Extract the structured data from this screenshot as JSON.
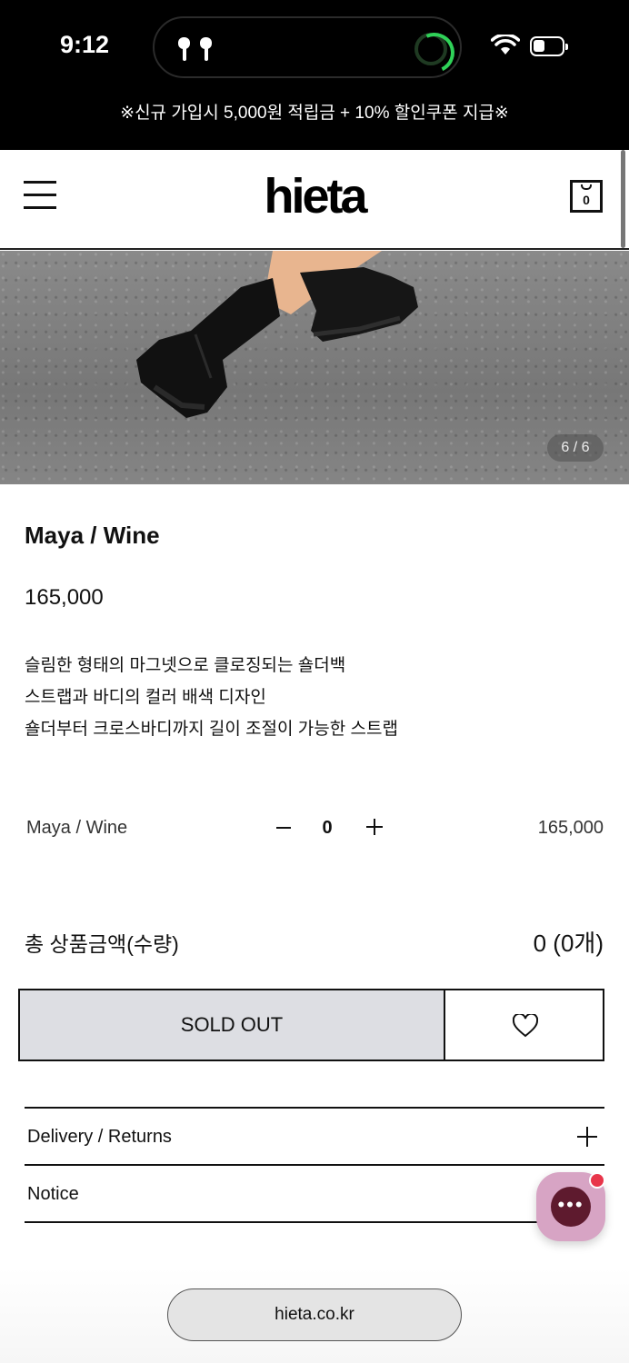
{
  "status_bar": {
    "time": "9:12"
  },
  "promo": {
    "text": "※신규 가입시 5,000원 적립금 + 10% 할인쿠폰 지급※"
  },
  "header": {
    "logo": "hieta",
    "cart_count": "0"
  },
  "gallery": {
    "pager": "6 / 6"
  },
  "product": {
    "title": "Maya / Wine",
    "price": "165,000",
    "description": [
      "슬림한 형태의 마그넷으로 클로징되는 숄더백",
      "스트랩과 바디의 컬러 배색 디자인",
      "숄더부터 크로스바디까지 길이 조절이 가능한 스트랩"
    ]
  },
  "option": {
    "name": "Maya / Wine",
    "quantity": "0",
    "price": "165,000"
  },
  "total": {
    "label": "총 상품금액(수량)",
    "value": "0 (0개)"
  },
  "actions": {
    "sold_out_label": "SOLD OUT"
  },
  "accordion": [
    {
      "label": "Delivery / Returns"
    },
    {
      "label": "Notice"
    }
  ],
  "browser": {
    "url": "hieta.co.kr"
  }
}
